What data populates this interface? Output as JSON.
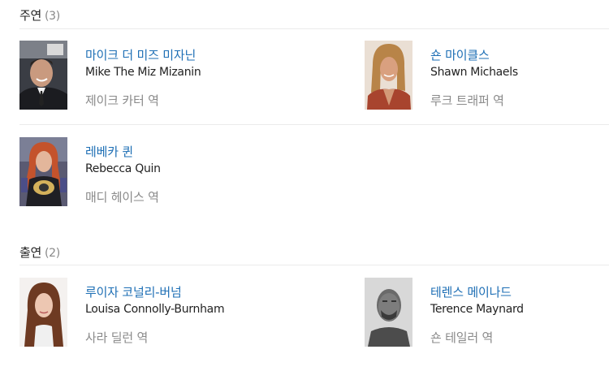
{
  "sections": [
    {
      "title": "주연",
      "count": "(3)",
      "cast": [
        {
          "name_ko": "마이크 더 미즈 미자닌",
          "name_en": "Mike The Miz Mizanin",
          "role": "제이크 카터 역"
        },
        {
          "name_ko": "숀 마이클스",
          "name_en": "Shawn Michaels",
          "role": "루크 트래퍼 역"
        },
        {
          "name_ko": "레베카 퀸",
          "name_en": "Rebecca Quin",
          "role": "매디 헤이스 역"
        }
      ]
    },
    {
      "title": "출연",
      "count": "(2)",
      "cast": [
        {
          "name_ko": "루이자 코널리-버넘",
          "name_en": "Louisa Connolly-Burnham",
          "role": "사라 딜런 역"
        },
        {
          "name_ko": "테렌스 메이나드",
          "name_en": "Terence Maynard",
          "role": "숀 테일러 역"
        }
      ]
    }
  ],
  "colors": {
    "link": "#1e6fb5",
    "role_text": "#8a8a8a",
    "divider": "#ebebeb"
  }
}
